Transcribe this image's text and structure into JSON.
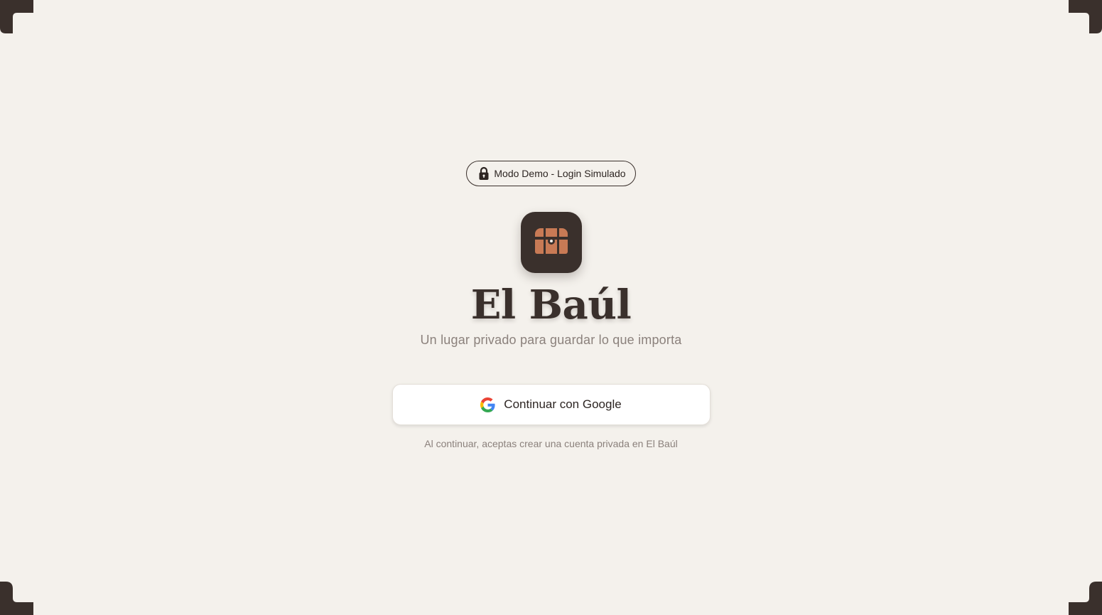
{
  "demo_badge": {
    "icon": "lock-icon",
    "label": "Modo Demo - Login Simulado"
  },
  "app": {
    "logo_icon": "treasure-chest-icon",
    "title": "El Baúl",
    "subtitle": "Un lugar privado para guardar lo que importa"
  },
  "login": {
    "google_icon": "google-icon",
    "google_button_label": "Continuar con Google",
    "terms": "Al continuar, aceptas crear una cuenta privada en El Baúl"
  },
  "colors": {
    "background": "#f4f1ec",
    "primary_dark": "#3a302c",
    "accent": "#c87a55",
    "muted_text": "#8b817c"
  }
}
